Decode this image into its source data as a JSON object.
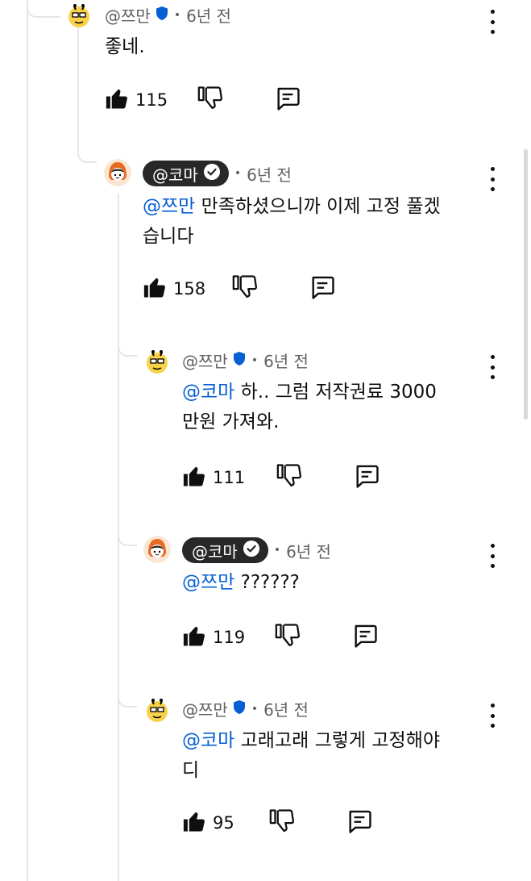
{
  "comments": [
    {
      "author": "@쯔만",
      "time": "6년 전",
      "text": "좋네.",
      "mention": "",
      "likes": "115"
    },
    {
      "author": "@코마",
      "time": "6년 전",
      "mention": "@쯔만",
      "text_line1": "만족하셨으니까 이제 고정 풀겠",
      "text_line2": "습니다",
      "likes": "158"
    },
    {
      "author": "@쯔만",
      "time": "6년 전",
      "mention": "@코마",
      "text_line1": "하.. 그럼 저작권료 3000",
      "text_line2": "만원 가져와.",
      "likes": "111"
    },
    {
      "author": "@코마",
      "time": "6년 전",
      "mention": "@쯔만",
      "text_line1": "??????",
      "likes": "119"
    },
    {
      "author": "@쯔만",
      "time": "6년 전",
      "mention": "@코마",
      "text_line1": "고래고래 그렇게 고정해야",
      "text_line2": "디",
      "likes": "95"
    }
  ],
  "dot_separator": "•",
  "icons": {
    "like": "thumb-up-icon",
    "dislike": "thumb-down-icon",
    "reply": "reply-icon",
    "more": "more-vert-icon",
    "verified": "verified-check-icon",
    "member": "shield-badge-icon"
  },
  "colors": {
    "mention": "#065fd4",
    "owner_chip": "#282828",
    "badge_blue": "#065fd4",
    "meta_gray": "#606060"
  }
}
